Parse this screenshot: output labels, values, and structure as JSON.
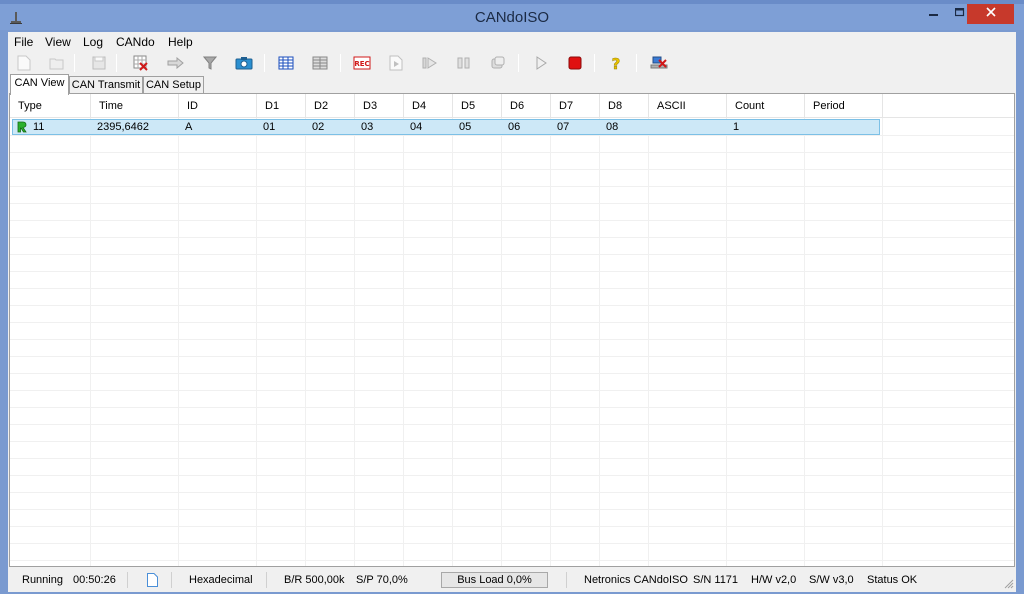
{
  "window": {
    "title": "CANdoISO"
  },
  "menu": [
    "File",
    "View",
    "Log",
    "CANdo",
    "Help"
  ],
  "tabs": [
    "CAN View",
    "CAN Transmit",
    "CAN Setup"
  ],
  "table": {
    "columns": [
      "Type",
      "Time",
      "ID",
      "D1",
      "D2",
      "D3",
      "D4",
      "D5",
      "D6",
      "D7",
      "D8",
      "ASCII",
      "Count",
      "Period"
    ],
    "rows": [
      {
        "type": "11",
        "time": "2395,6462",
        "id": "A",
        "d1": "01",
        "d2": "02",
        "d3": "03",
        "d4": "04",
        "d5": "05",
        "d6": "06",
        "d7": "07",
        "d8": "08",
        "ascii": "",
        "count": "1",
        "period": ""
      }
    ]
  },
  "status": {
    "state": "Running",
    "elapsed": "00:50:26",
    "format": "Hexadecimal",
    "baud_rate": "B/R 500,00k",
    "sample_point": "S/P 70,0%",
    "bus_load": "Bus Load 0,0%",
    "device": "Netronics CANdoISO",
    "serial": "S/N 1171",
    "hw": "H/W v2,0",
    "sw": "S/W v3,0",
    "health": "Status OK"
  },
  "colors": {
    "selection": "#cde8f7",
    "title_bar": "#7e9fd6",
    "close_button": "#c7392b"
  }
}
